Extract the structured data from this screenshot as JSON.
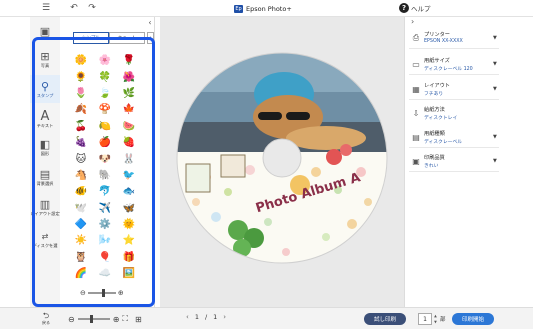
{
  "titlebar": {
    "app_name": "Epson Photo+",
    "logo_text": "Ep",
    "help_label": "ヘルプ",
    "menu_icon": "hamburger-icon",
    "undo_icon": "undo-icon",
    "redo_icon": "redo-icon"
  },
  "leftnav": {
    "items": [
      {
        "label": "写真",
        "icon": "photo-add-icon"
      },
      {
        "label": "スタンプ",
        "icon": "stamp-icon"
      },
      {
        "label": "テキスト",
        "icon": "text-icon"
      },
      {
        "label": "図形",
        "icon": "shape-icon"
      },
      {
        "label": "背景選択",
        "icon": "background-icon"
      },
      {
        "label": "レイアウト設定",
        "icon": "layout-icon"
      },
      {
        "label": "ディスクを選",
        "icon": "disc-select-icon"
      }
    ]
  },
  "stamp_panel": {
    "tabs": [
      {
        "label": "シンプル",
        "active": true
      },
      {
        "label": "キュート",
        "active": false
      }
    ],
    "stamps": [
      "🌼",
      "🌸",
      "🌹",
      "🌻",
      "🍀",
      "🌺",
      "🌷",
      "🍃",
      "🌿",
      "🍂",
      "🍄",
      "🍁",
      "🍒",
      "🍋",
      "🍉",
      "🍇",
      "🍎",
      "🍓",
      "🐱",
      "🐶",
      "🐰",
      "🐴",
      "🐘",
      "🐦",
      "🐠",
      "🐬",
      "🐟",
      "🕊️",
      "✈️",
      "🦋",
      "🔷",
      "⚙️",
      "🌞",
      "☀️",
      "🌬️",
      "⭐",
      "🦉",
      "🎈",
      "🎁",
      "🌈",
      "☁️",
      "🖼️"
    ]
  },
  "canvas": {
    "disc_title": "Photo Album A"
  },
  "bottombar": {
    "back_label": "戻る",
    "page_current": "1",
    "page_sep": "/",
    "page_total": "1",
    "test_print_label": "試し印刷",
    "copies_value": "1",
    "copies_unit": "部",
    "print_label": "印刷開始"
  },
  "settings": [
    {
      "name": "プリンター",
      "value": "EPSON XX-XXXX",
      "icon": "printer-icon"
    },
    {
      "name": "用紙サイズ",
      "value": "ディスクレーベル 120",
      "icon": "paper-size-icon"
    },
    {
      "name": "レイアウト",
      "value": "フチあり",
      "icon": "layout-border-icon"
    },
    {
      "name": "給紙方法",
      "value": "ディスクトレイ",
      "icon": "paper-feed-icon"
    },
    {
      "name": "用紙種類",
      "value": "ディスクレーベル",
      "icon": "paper-type-icon"
    },
    {
      "name": "印刷品質",
      "value": "きれい",
      "icon": "print-quality-icon"
    }
  ],
  "colors": {
    "highlight": "#1a55e6",
    "accent": "#2a5aa8",
    "print_button": "#2c77d6",
    "test_button": "#3b4f78"
  }
}
